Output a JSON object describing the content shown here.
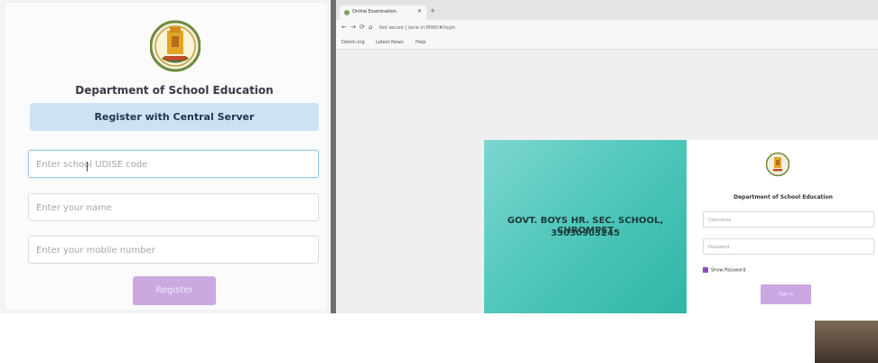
{
  "left": {
    "department": "Department of School Education",
    "banner": "Register with Central Server",
    "udise_placeholder": "Enter school UDISE code",
    "name_placeholder": "Enter your name",
    "mobile_placeholder": "Enter your mobile number",
    "register_label": "Register"
  },
  "browser": {
    "tab_title": "Online Examination",
    "tab_close": "×",
    "new_tab": "+",
    "nav": {
      "back": "←",
      "forward": "→",
      "reload": "⟳",
      "home": "⌂"
    },
    "url": "Not secure | lanie.in:8080/#/login",
    "bookmarks": [
      "Deloin.org",
      "Latest News",
      "Help"
    ]
  },
  "page": {
    "school_name": "GOVT. BOYS HR. SEC. SCHOOL, CHROMPET",
    "school_code": "33030903245",
    "department": "Department of School Education",
    "username_placeholder": "Username",
    "password_placeholder": "Password",
    "show_password_label": "Show Password",
    "sign_in_label": "Sign In"
  },
  "colors": {
    "teal": "#2fb6a6",
    "button_lavender": "#cba9e0",
    "banner_blue": "#cfe2f5"
  }
}
